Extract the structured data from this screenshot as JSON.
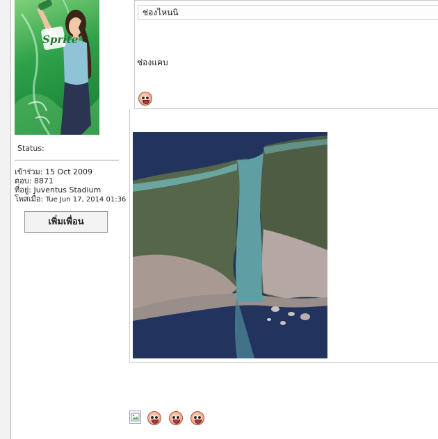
{
  "profile": {
    "status_label": "Status:",
    "joined": "เข้าร่วม: 15 Oct 2009",
    "posts": "ตอบ: 8871",
    "location": "ที่อยู่: Juventus Stadium",
    "posted_prefix": "โพสเมื่อ:",
    "posted_date": "Tue Jun 17, 2014 01:36",
    "add_friend_label": "เพิ่มเพื่อน",
    "avatar_brand": "Sprite"
  },
  "quote": {
    "input_value": "ช่องไหนนิ",
    "body_text": "ช่องแคบ"
  },
  "icons": {
    "smiley": "smiley-icon",
    "broken_image": "broken-image-icon"
  },
  "colors": {
    "avatar_green": "#2fa24a",
    "sea_blue": "#22345e",
    "strait_teal": "#5f9fa3",
    "land_green": "#56664a",
    "city_tan": "#a89a92"
  }
}
